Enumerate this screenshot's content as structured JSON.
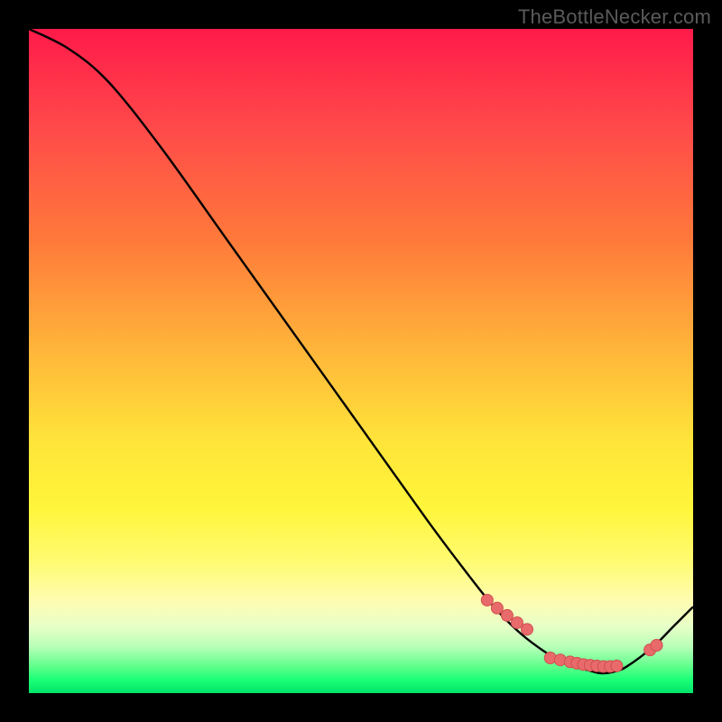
{
  "watermark": "TheBottleNecker.com",
  "colors": {
    "curve_stroke": "#000000",
    "dot_fill": "#e86a6a",
    "dot_stroke": "#d05050",
    "background_black": "#000000"
  },
  "chart_data": {
    "type": "line",
    "title": "",
    "xlabel": "",
    "ylabel": "",
    "xlim": [
      0,
      100
    ],
    "ylim": [
      0,
      100
    ],
    "series": [
      {
        "name": "curve",
        "x": [
          0,
          6,
          12,
          20,
          30,
          40,
          50,
          60,
          66,
          70,
          74,
          78,
          80,
          82,
          84,
          86,
          88,
          90,
          94,
          97,
          100
        ],
        "y": [
          100,
          97,
          92,
          82,
          68,
          54,
          40,
          26,
          18,
          13,
          9,
          6,
          5,
          4,
          3.5,
          3,
          3.2,
          4,
          7,
          10,
          13
        ]
      }
    ],
    "dots": [
      {
        "x": 69,
        "y": 14
      },
      {
        "x": 70.5,
        "y": 12.8
      },
      {
        "x": 72,
        "y": 11.7
      },
      {
        "x": 73.5,
        "y": 10.6
      },
      {
        "x": 75,
        "y": 9.6
      },
      {
        "x": 78.5,
        "y": 5.3
      },
      {
        "x": 80,
        "y": 5.0
      },
      {
        "x": 81.5,
        "y": 4.7
      },
      {
        "x": 82.5,
        "y": 4.5
      },
      {
        "x": 83.5,
        "y": 4.3
      },
      {
        "x": 84.5,
        "y": 4.2
      },
      {
        "x": 85.5,
        "y": 4.1
      },
      {
        "x": 86.5,
        "y": 4.0
      },
      {
        "x": 87.5,
        "y": 4.0
      },
      {
        "x": 88.5,
        "y": 4.1
      },
      {
        "x": 93.5,
        "y": 6.5
      },
      {
        "x": 94.5,
        "y": 7.2
      }
    ]
  }
}
